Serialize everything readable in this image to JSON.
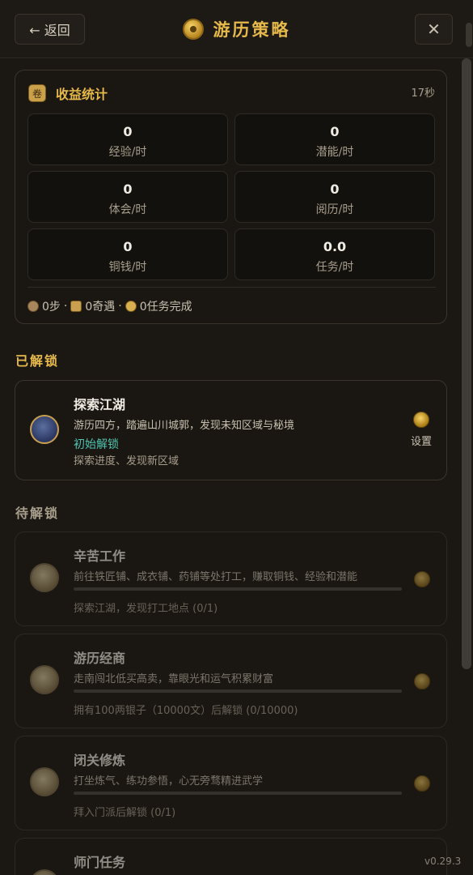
{
  "header": {
    "back_label": "← 返回",
    "title": "游历策略",
    "close_label": "✕"
  },
  "stats": {
    "title": "收益统计",
    "elapsed": "17秒",
    "cells": [
      {
        "value": "0",
        "label": "经验/时"
      },
      {
        "value": "0",
        "label": "潜能/时"
      },
      {
        "value": "0",
        "label": "体会/时"
      },
      {
        "value": "0",
        "label": "阅历/时"
      },
      {
        "value": "0",
        "label": "铜钱/时"
      },
      {
        "value": "0.0",
        "label": "任务/时"
      }
    ],
    "footer": {
      "steps": "0步",
      "sep1": "·",
      "encounters": "0奇遇",
      "sep2": "·",
      "tasks": "0任务完成"
    }
  },
  "sections": {
    "unlocked": "已解锁",
    "locked": "待解锁"
  },
  "unlocked_features": [
    {
      "title": "探索江湖",
      "desc": "游历四方，踏遍山川城郭，发现未知区域与秘境",
      "unlock": "初始解锁",
      "note": "探索进度、发现新区域",
      "settings_label": "设置"
    }
  ],
  "locked_features": [
    {
      "title": "辛苦工作",
      "desc": "前往铁匠铺、成衣铺、药铺等处打工，赚取铜钱、经验和潜能",
      "requirement": "探索江湖，发现打工地点 (0/1)",
      "progress": 0
    },
    {
      "title": "游历经商",
      "desc": "走南闯北低买高卖，靠眼光和运气积累财富",
      "requirement": "拥有100两银子（10000文）后解锁 (0/10000)",
      "progress": 0
    },
    {
      "title": "闭关修炼",
      "desc": "打坐炼气、练功参悟，心无旁骛精进武学",
      "requirement": "拜入门派后解锁 (0/1)",
      "progress": 0
    },
    {
      "title": "师门任务",
      "desc": "",
      "requirement": "",
      "progress": 0
    }
  ],
  "version": "v0.29.3",
  "colors": {
    "accent": "#e6b94a",
    "unlock_text": "#4fc4b0",
    "background": "#1b1814"
  }
}
